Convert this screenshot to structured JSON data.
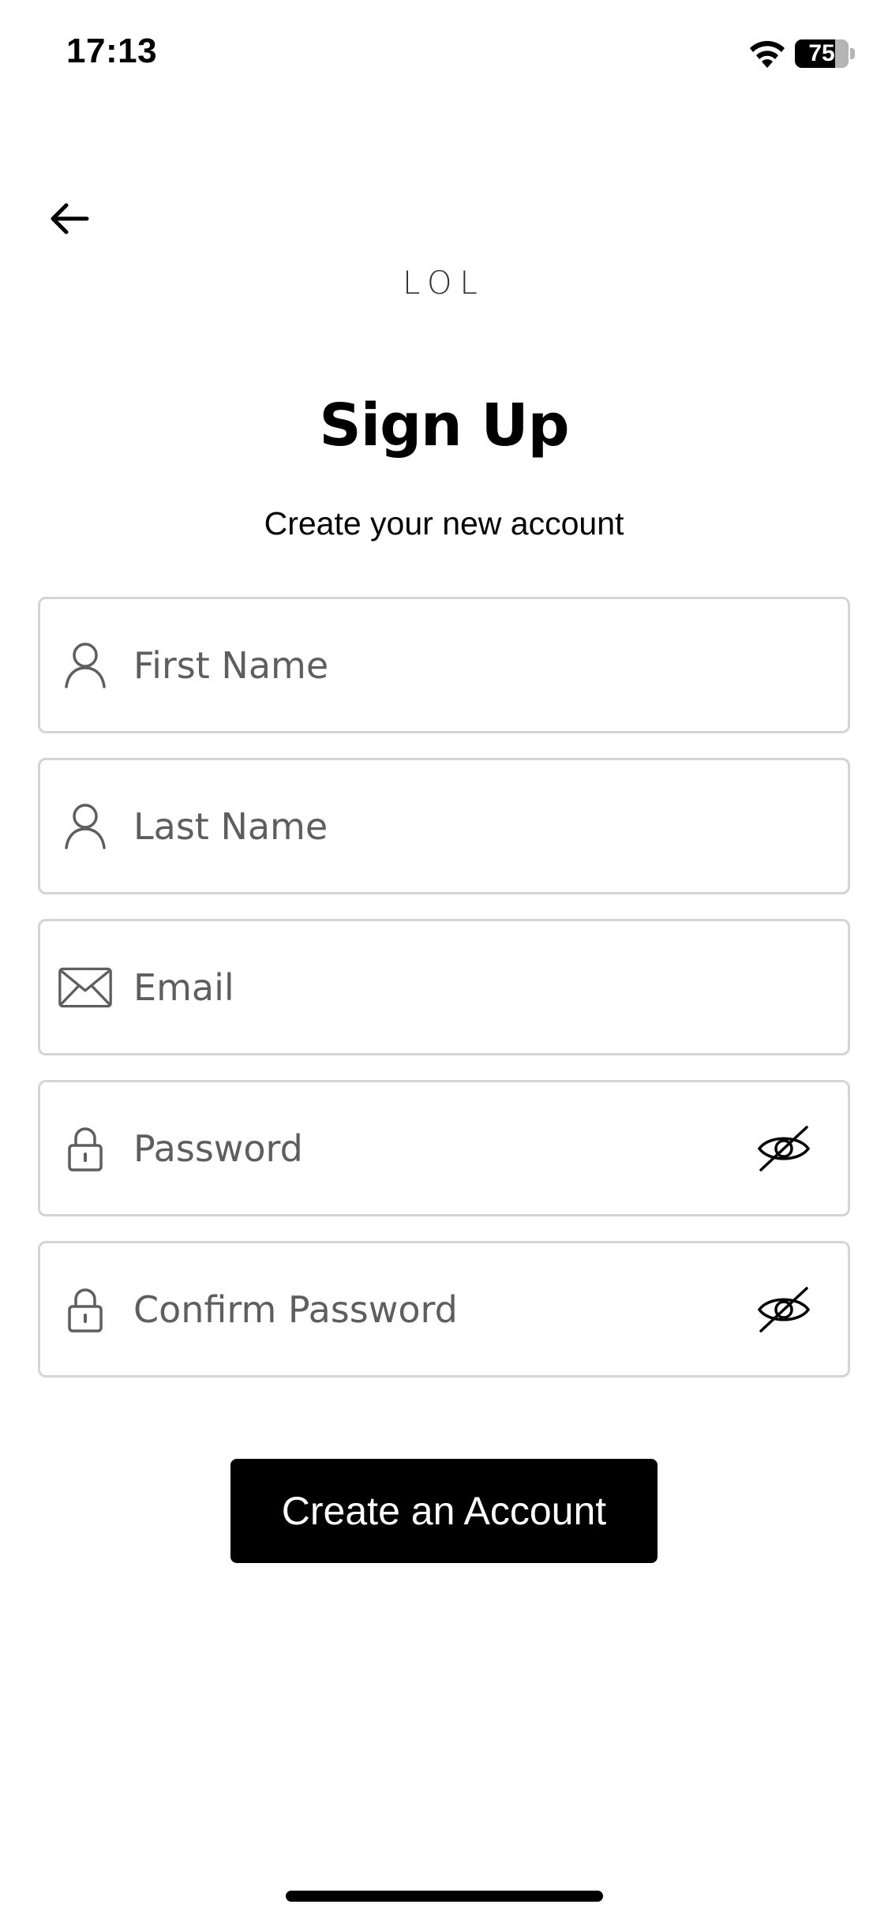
{
  "status_bar": {
    "time": "17:13",
    "battery_level": "75",
    "battery_fraction": 0.75
  },
  "header": {
    "logo": "LOL",
    "title": "Sign Up",
    "subtitle": "Create your new account"
  },
  "form": {
    "first_name": {
      "placeholder": "First Name",
      "icon": "user-icon"
    },
    "last_name": {
      "placeholder": "Last Name",
      "icon": "user-icon"
    },
    "email": {
      "placeholder": "Email",
      "icon": "mail-icon"
    },
    "password": {
      "placeholder": "Password",
      "icon": "lock-icon",
      "toggle_icon": "eye-off-icon"
    },
    "confirm_password": {
      "placeholder": "Confirm Password",
      "icon": "lock-icon",
      "toggle_icon": "eye-off-icon"
    }
  },
  "actions": {
    "create_account_label": "Create an Account"
  },
  "colors": {
    "field_border": "#d4d4d4",
    "placeholder": "#5e5e5e",
    "button_bg": "#000000",
    "button_text": "#ffffff"
  }
}
